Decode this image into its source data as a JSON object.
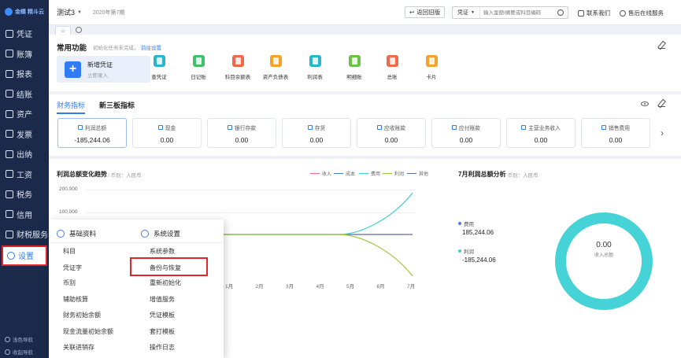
{
  "sidebar": {
    "logo_text": "金蝶 精斗云",
    "items": [
      {
        "label": "凭证",
        "icon": "voucher-icon"
      },
      {
        "label": "账簿",
        "icon": "ledger-icon"
      },
      {
        "label": "报表",
        "icon": "report-icon"
      },
      {
        "label": "结账",
        "icon": "closing-icon"
      },
      {
        "label": "资产",
        "icon": "asset-icon"
      },
      {
        "label": "发票",
        "icon": "invoice-icon"
      },
      {
        "label": "出纳",
        "icon": "cashier-icon"
      },
      {
        "label": "工资",
        "icon": "salary-icon"
      },
      {
        "label": "税务",
        "icon": "tax-icon"
      },
      {
        "label": "信用",
        "icon": "credit-icon"
      },
      {
        "label": "财税服务",
        "icon": "finance-service-icon"
      },
      {
        "label": "设置",
        "icon": "settings-icon",
        "active": true
      }
    ],
    "bottom": [
      {
        "label": "浅色导航"
      },
      {
        "label": "收起导航"
      }
    ]
  },
  "topbar": {
    "account": "测试3",
    "period": "2020年第7期",
    "return_label": "返回旧版",
    "search_type": "凭证",
    "search_placeholder": "输入金额/摘要或科目编码",
    "contact_label": "联系我们",
    "service_label": "售后在线服务"
  },
  "common": {
    "title": "常用功能",
    "hint": "初始化任务未完成，",
    "hint_link": "前往设置",
    "new_voucher_title": "新增凭证",
    "new_voucher_sub": "立即录入",
    "functions": [
      {
        "label": "查凭证",
        "color": "#2bb5c9"
      },
      {
        "label": "日记账",
        "color": "#3fbf6a"
      },
      {
        "label": "科目余额表",
        "color": "#ee6a4a"
      },
      {
        "label": "资产负债表",
        "color": "#f3a32b"
      },
      {
        "label": "利润表",
        "color": "#2bb5c9"
      },
      {
        "label": "明细账",
        "color": "#6cc04a"
      },
      {
        "label": "总账",
        "color": "#ee6a4a"
      },
      {
        "label": "卡片",
        "color": "#f3a32b"
      }
    ]
  },
  "indicators": {
    "tabs": [
      "财务指标",
      "新三板指标"
    ],
    "cards": [
      {
        "title": "利润总额",
        "value": "-185,244.06"
      },
      {
        "title": "现金",
        "value": "0.00"
      },
      {
        "title": "银行存款",
        "value": "0.00"
      },
      {
        "title": "存货",
        "value": "0.00"
      },
      {
        "title": "应收账款",
        "value": "0.00"
      },
      {
        "title": "应付账款",
        "value": "0.00"
      },
      {
        "title": "主营业务收入",
        "value": "0.00"
      },
      {
        "title": "销售费用",
        "value": "0.00"
      }
    ]
  },
  "trend": {
    "title": "利润总额变化趋势",
    "currency": "/ 币别：人民币",
    "legend": [
      {
        "name": "收入",
        "color": "#e8727a"
      },
      {
        "name": "成本",
        "color": "#4a7fd4"
      },
      {
        "name": "费用",
        "color": "#3ecfcf"
      },
      {
        "name": "利润",
        "color": "#9ccc3c"
      },
      {
        "name": "其他",
        "color": "#5b6aa0"
      }
    ],
    "y_ticks": [
      "200,000",
      "100,000"
    ],
    "x_ticks": [
      "1月",
      "2月",
      "3月",
      "4月",
      "5月",
      "6月",
      "7月"
    ]
  },
  "chart_data": {
    "type": "line",
    "title": "利润总额变化趋势",
    "x": [
      "1月",
      "2月",
      "3月",
      "4月",
      "5月",
      "6月",
      "7月"
    ],
    "series": [
      {
        "name": "收入",
        "values": [
          0,
          0,
          0,
          0,
          0,
          0,
          0
        ]
      },
      {
        "name": "成本",
        "values": [
          0,
          0,
          0,
          0,
          0,
          0,
          0
        ]
      },
      {
        "name": "费用",
        "values": [
          0,
          0,
          0,
          0,
          0,
          0,
          185244.06
        ]
      },
      {
        "name": "利润",
        "values": [
          0,
          0,
          0,
          0,
          0,
          0,
          -185244.06
        ]
      },
      {
        "name": "其他",
        "values": [
          0,
          0,
          0,
          0,
          0,
          0,
          0
        ]
      }
    ],
    "ylim": [
      -200000,
      200000
    ]
  },
  "profit_analysis": {
    "title": "7月利润总额分析",
    "currency": "/ 币别：人民币",
    "items": [
      {
        "name": "费用",
        "value": "185,244.06",
        "color": "#4a7fd4"
      },
      {
        "name": "利润",
        "value": "-185,244.06",
        "color": "#3ecfcf"
      }
    ],
    "center_value": "0.00",
    "center_label": "收入总额"
  },
  "settings_menu": {
    "col1_title": "基础资料",
    "col1_items": [
      "科目",
      "凭证字",
      "币别",
      "辅助核算",
      "财务初始余额",
      "现金流量初始余额",
      "关联进销存"
    ],
    "col2_title": "系统设置",
    "col2_items": [
      "系统参数",
      "备份与恢复",
      "重新初始化",
      "增值服务",
      "凭证模板",
      "套打模板",
      "操作日志"
    ]
  }
}
